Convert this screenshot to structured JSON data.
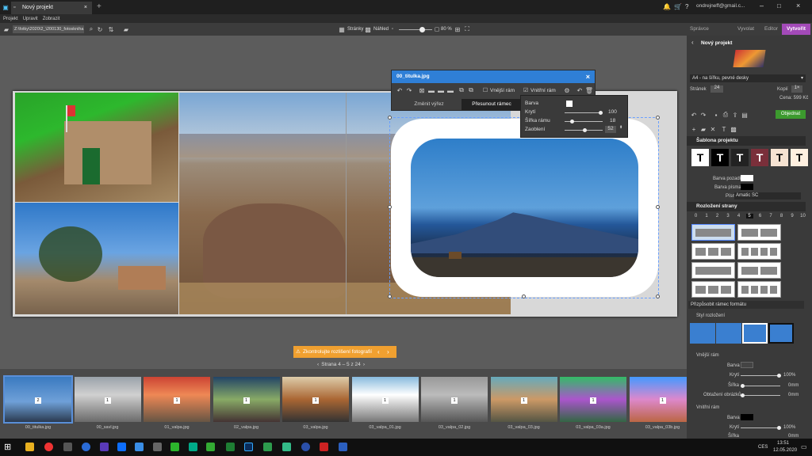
{
  "window": {
    "tab_title": "Nový projekt",
    "user": "ondrejneff@gmail.c..."
  },
  "menu": [
    "Projekt",
    "Upravit",
    "Zobrazit"
  ],
  "toolbar": {
    "path": "Z:\\fotky\\2020\\2_\\200130_fotoskniha",
    "pages_label": "Stránky",
    "preview_label": "Náhled",
    "zoom": "80 %",
    "zoom_fraction": 0.7
  },
  "mode_tabs": {
    "items": [
      "Správce",
      "Vyvolat",
      "Editor"
    ],
    "create": "Vytvořit"
  },
  "dialog": {
    "title": "00_titulka.jpg",
    "outer_frame": "Vnější rám",
    "inner_frame": "Vnitřní rám",
    "change_crop": "Změnit výřez",
    "move_frame": "Přesunout rámec"
  },
  "popup": {
    "color_label": "Barva",
    "opacity_label": "Krytí",
    "opacity_value": "100",
    "width_label": "Šířka rámu",
    "width_value": "18",
    "rounding_label": "Zaoblení",
    "rounding_value": "52"
  },
  "warning": "Zkontrolujte rozlišení fotografií",
  "pager": "Strana 4 – 5 z 24",
  "thumbnails": [
    {
      "name": "00_titulka.jpg",
      "count": "2"
    },
    {
      "name": "00_savl.jpg",
      "count": "1"
    },
    {
      "name": "01_valpa.jpg",
      "count": "1"
    },
    {
      "name": "02_valpa.jpg",
      "count": "1"
    },
    {
      "name": "03_valpa.jpg",
      "count": "1"
    },
    {
      "name": "03_valpa_01.jpg",
      "count": "1"
    },
    {
      "name": "03_valpa_02.jpg",
      "count": "1"
    },
    {
      "name": "03_valpa_03.jpg",
      "count": "1"
    },
    {
      "name": "03_valpa_03a.jpg",
      "count": "1"
    },
    {
      "name": "03_valpa_03b.jpg",
      "count": "1"
    }
  ],
  "panel": {
    "project_title": "Nový projekt",
    "format": "A4 - na šířku, pevné desky",
    "pages_label": "Stránek",
    "pages_value": "24",
    "copies_label": "Kopií",
    "copies_value": "1×",
    "price": "Cena: 599 Kč",
    "order_button": "Objednat",
    "template_section": "Šablona projektu",
    "templates": [
      {
        "letter": "T",
        "bg": "#ffffff",
        "fg": "#000000"
      },
      {
        "letter": "T",
        "bg": "#000000",
        "fg": "#ffffff"
      },
      {
        "letter": "T",
        "bg": "#222222",
        "fg": "#ffffff"
      },
      {
        "letter": "T",
        "bg": "#7a2f3a",
        "fg": "#ffffff"
      },
      {
        "letter": "T",
        "bg": "#f6e3d2",
        "fg": "#000000"
      },
      {
        "letter": "T",
        "bg": "#fff0e0",
        "fg": "#000000"
      }
    ],
    "bg_color_label": "Barva pozadí",
    "font_color_label": "Barva písma",
    "font_label": "Písmo",
    "font_value": "Amatic SC",
    "layout_section": "Rozložení strany",
    "layout_numbers": [
      "0",
      "1",
      "2",
      "3",
      "4",
      "5",
      "6",
      "7",
      "8",
      "9",
      "10"
    ],
    "adapt_label": "Přizpůsobit rámec formátu",
    "style_section": "Styl rozložení",
    "outer_frame_section": "Vnější rám",
    "color_label": "Barva",
    "opacity_label": "Krytí",
    "opacity_value": "100%",
    "width_label": "Šířka",
    "width_value": "0mm",
    "wrap_label": "Obtažení obrázků",
    "wrap_value": "0mm",
    "inner_frame_section": "Vnitřní rám",
    "inner_opacity_value": "100%",
    "inner_width_value": "0mm"
  },
  "taskbar": {
    "lang": "CES",
    "time": "13:51",
    "date": "12.05.2020"
  }
}
